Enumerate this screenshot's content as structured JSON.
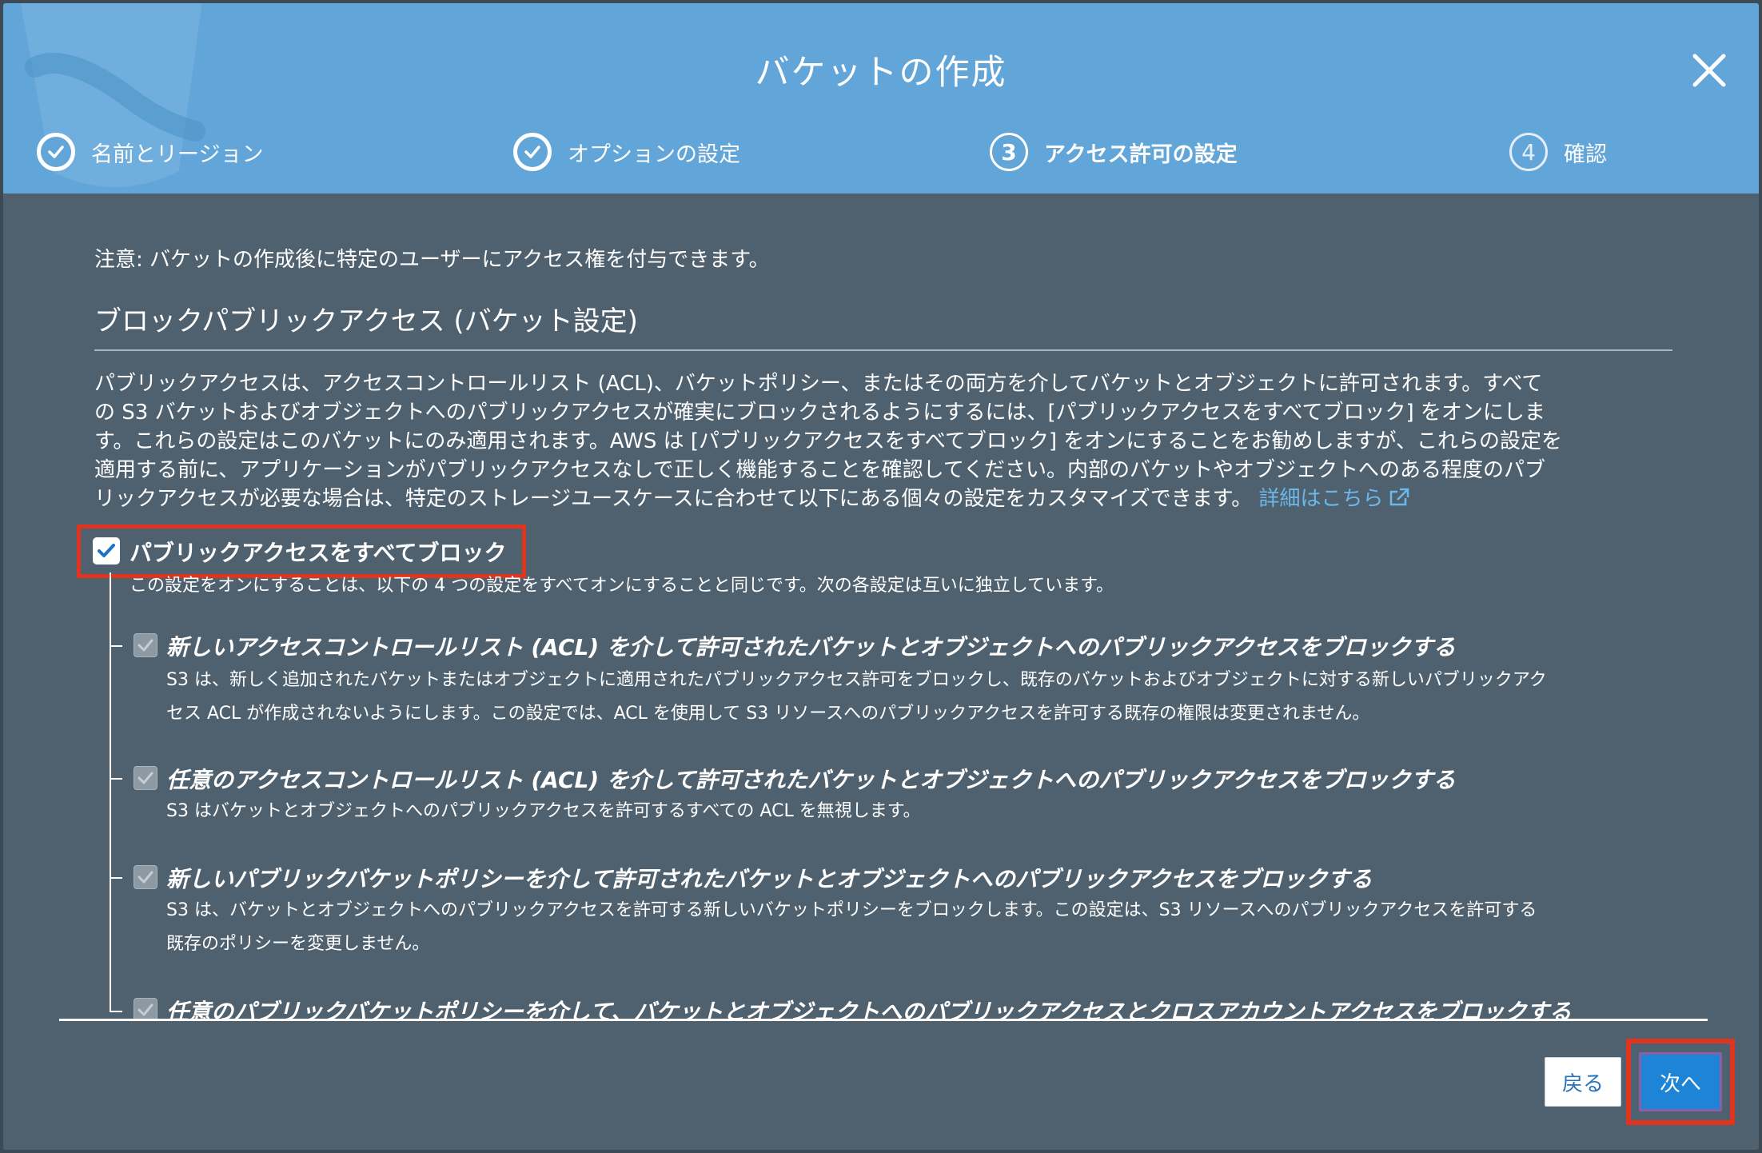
{
  "dialog": {
    "title": "バケットの作成",
    "steps": [
      {
        "number": "1",
        "label": "名前とリージョン",
        "state": "done"
      },
      {
        "number": "2",
        "label": "オプションの設定",
        "state": "done"
      },
      {
        "number": "3",
        "label": "アクセス許可の設定",
        "state": "current"
      },
      {
        "number": "4",
        "label": "確認",
        "state": "future"
      }
    ]
  },
  "body": {
    "note": "注意: バケットの作成後に特定のユーザーにアクセス権を付与できます。",
    "section_title": "ブロックパブリックアクセス (バケット設定)",
    "description_lines": [
      "パブリックアクセスは、アクセスコントロールリスト (ACL)、バケットポリシー、またはその両方を介してバケットとオブジェクトに許可されます。すべて",
      "の S3 バケットおよびオブジェクトへのパブリックアクセスが確実にブロックされるようにするには、[パブリックアクセスをすべてブロック] をオンにしま",
      "す。これらの設定はこのバケットにのみ適用されます。AWS は [パブリックアクセスをすべてブロック] をオンにすることをお勧めしますが、これらの設定を",
      "適用する前に、アプリケーションがパブリックアクセスなしで正しく機能することを確認してください。内部のバケットやオブジェクトへのある程度のパブ",
      "リックアクセスが必要な場合は、特定のストレージユースケースに合わせて以下にある個々の設定をカスタマイズできます。"
    ],
    "learn_more": "詳細はこちら",
    "block_all": {
      "label": "パブリックアクセスをすべてブロック",
      "checked": true,
      "hint": "この設定をオンにすることは、以下の 4 つの設定をすべてオンにすることと同じです。次の各設定は互いに独立しています。"
    },
    "options": [
      {
        "title": "新しいアクセスコントロールリスト (ACL) を介して許可されたバケットとオブジェクトへのパブリックアクセスをブロックする",
        "desc1": "S3 は、新しく追加されたバケットまたはオブジェクトに適用されたパブリックアクセス許可をブロックし、既存のバケットおよびオブジェクトに対する新しいパブリックアク",
        "desc2": "セス ACL が作成されないようにします。この設定では、ACL を使用して S3 リソースへのパブリックアクセスを許可する既存の権限は変更されません。",
        "checked": true
      },
      {
        "title": "任意のアクセスコントロールリスト (ACL) を介して許可されたバケットとオブジェクトへのパブリックアクセスをブロックする",
        "desc1": "S3 はバケットとオブジェクトへのパブリックアクセスを許可するすべての ACL を無視します。",
        "desc2": "",
        "checked": true
      },
      {
        "title": "新しいパブリックバケットポリシーを介して許可されたバケットとオブジェクトへのパブリックアクセスをブロックする",
        "desc1": "S3 は、バケットとオブジェクトへのパブリックアクセスを許可する新しいバケットポリシーをブロックします。この設定は、S3 リソースへのパブリックアクセスを許可する",
        "desc2": "既存のポリシーを変更しません。",
        "checked": true
      },
      {
        "title": "任意のパブリックバケットポリシーを介して、バケットとオブジェクトへのパブリックアクセスとクロスアカウントアクセスをブロックする",
        "desc1": "",
        "desc2": "",
        "checked": true
      }
    ]
  },
  "footer": {
    "back_label": "戻る",
    "next_label": "次へ"
  },
  "colors": {
    "header": "#62a5d8",
    "body": "#4f616e",
    "link": "#6cb7ec",
    "highlight": "#e0341f",
    "primary_button": "#1d84d6"
  },
  "icons": {
    "close": "close-icon",
    "done_step": "checkmark-icon",
    "external_link": "external-link-icon"
  }
}
